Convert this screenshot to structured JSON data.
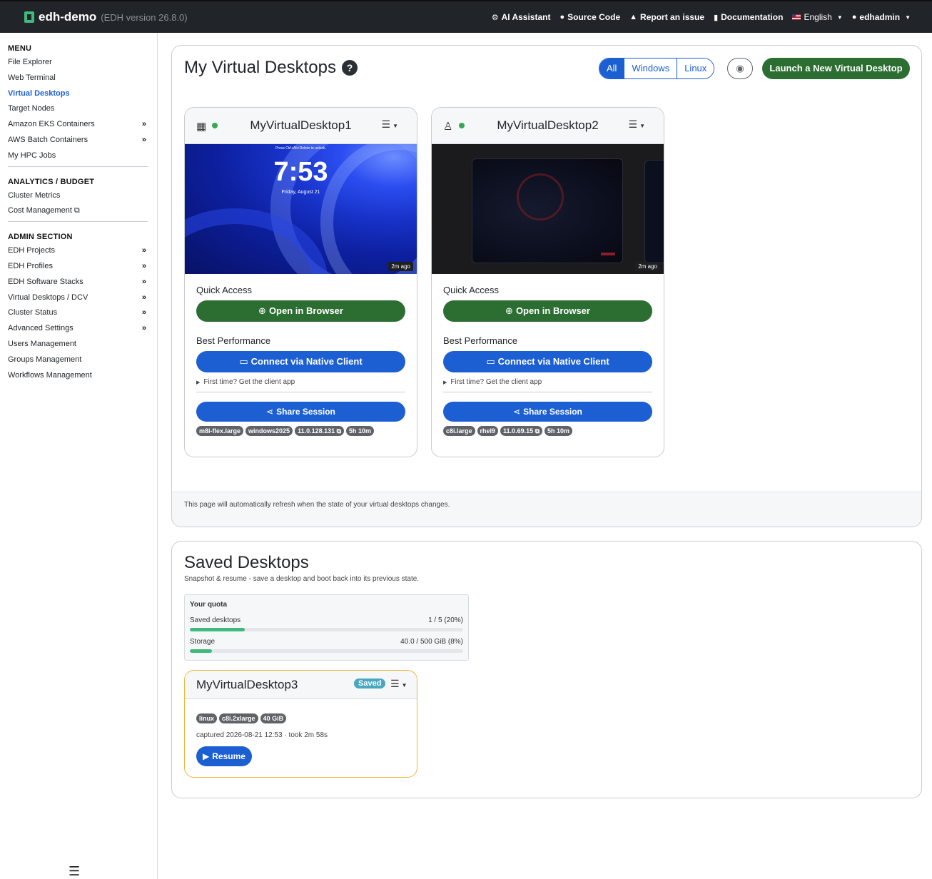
{
  "header": {
    "brand_name": "edh-demo",
    "version": "(EDH version 26.8.0)",
    "links": {
      "ai_assistant": "AI Assistant",
      "source_code": "Source Code",
      "report_issue": "Report an issue",
      "documentation": "Documentation",
      "language": "English",
      "user": "edhadmin"
    }
  },
  "sidebar": {
    "menu_heading": "MENU",
    "menu_items": [
      "File Explorer",
      "Web Terminal",
      "Virtual Desktops",
      "Target Nodes",
      "Amazon EKS Containers",
      "AWS Batch Containers",
      "My HPC Jobs"
    ],
    "analytics_heading": "ANALYTICS / BUDGET",
    "analytics_items": [
      "Cluster Metrics",
      "Cost Management"
    ],
    "admin_heading": "ADMIN SECTION",
    "admin_items": [
      "EDH Projects",
      "EDH Profiles",
      "EDH Software Stacks",
      "Virtual Desktops / DCV",
      "Cluster Status",
      "Advanced Settings",
      "Users Management",
      "Groups Management",
      "Workflows Management"
    ]
  },
  "virtual_desktops": {
    "title": "My Virtual Desktops",
    "filters": [
      "All",
      "Windows",
      "Linux"
    ],
    "launch_label": "Launch a New Virtual Desktop",
    "refresh_note": "This page will automatically refresh when the state of your virtual desktops changes.",
    "cards": [
      {
        "name": "MyVirtualDesktop1",
        "os_icon": "windows-icon",
        "status_color": "#3aa655",
        "lock_hint": "Press Ctrl+Alt+Delete to unlock.",
        "lock_time": "7:53",
        "lock_date": "Friday, August 21",
        "ago": "2m ago",
        "quick_access": "Quick Access",
        "open_browser": "Open in Browser",
        "best_performance": "Best Performance",
        "connect_native": "Connect via Native Client",
        "first_time": "First time? Get the client app",
        "share": "Share Session",
        "badges": [
          "m8i-flex.large",
          "windows2025",
          "11.0.128.131 ⧉",
          "5h 10m"
        ]
      },
      {
        "name": "MyVirtualDesktop2",
        "os_icon": "linux-icon",
        "status_color": "#3aa655",
        "ago": "2m ago",
        "quick_access": "Quick Access",
        "open_browser": "Open in Browser",
        "best_performance": "Best Performance",
        "connect_native": "Connect via Native Client",
        "first_time": "First time? Get the client app",
        "share": "Share Session",
        "badges": [
          "c8i.large",
          "rhel9",
          "11.0.69.15 ⧉",
          "5h 10m"
        ]
      }
    ]
  },
  "saved_desktops": {
    "title": "Saved Desktops",
    "subtitle": "Snapshot & resume - save a desktop and boot back into its previous state.",
    "quota": {
      "title": "Your quota",
      "saved_label": "Saved desktops",
      "saved_value": "1 / 5 (20%)",
      "saved_fraction": 0.2,
      "storage_label": "Storage",
      "storage_value": "40.0 / 500 GiB (8%)",
      "storage_fraction": 0.08
    },
    "card": {
      "name": "MyVirtualDesktop3",
      "status": "Saved",
      "badges": [
        "linux",
        "c8i.2xlarge",
        "40 GiB"
      ],
      "captured": "captured 2026-08-21 12:53 · took 2m 58s",
      "resume": "Resume"
    }
  },
  "colors": {
    "primary": "#1c5fd2",
    "success": "#2c6e31",
    "navbar": "#212529",
    "saved_border": "#f0b43c",
    "saved_badge": "#49a7c1"
  }
}
